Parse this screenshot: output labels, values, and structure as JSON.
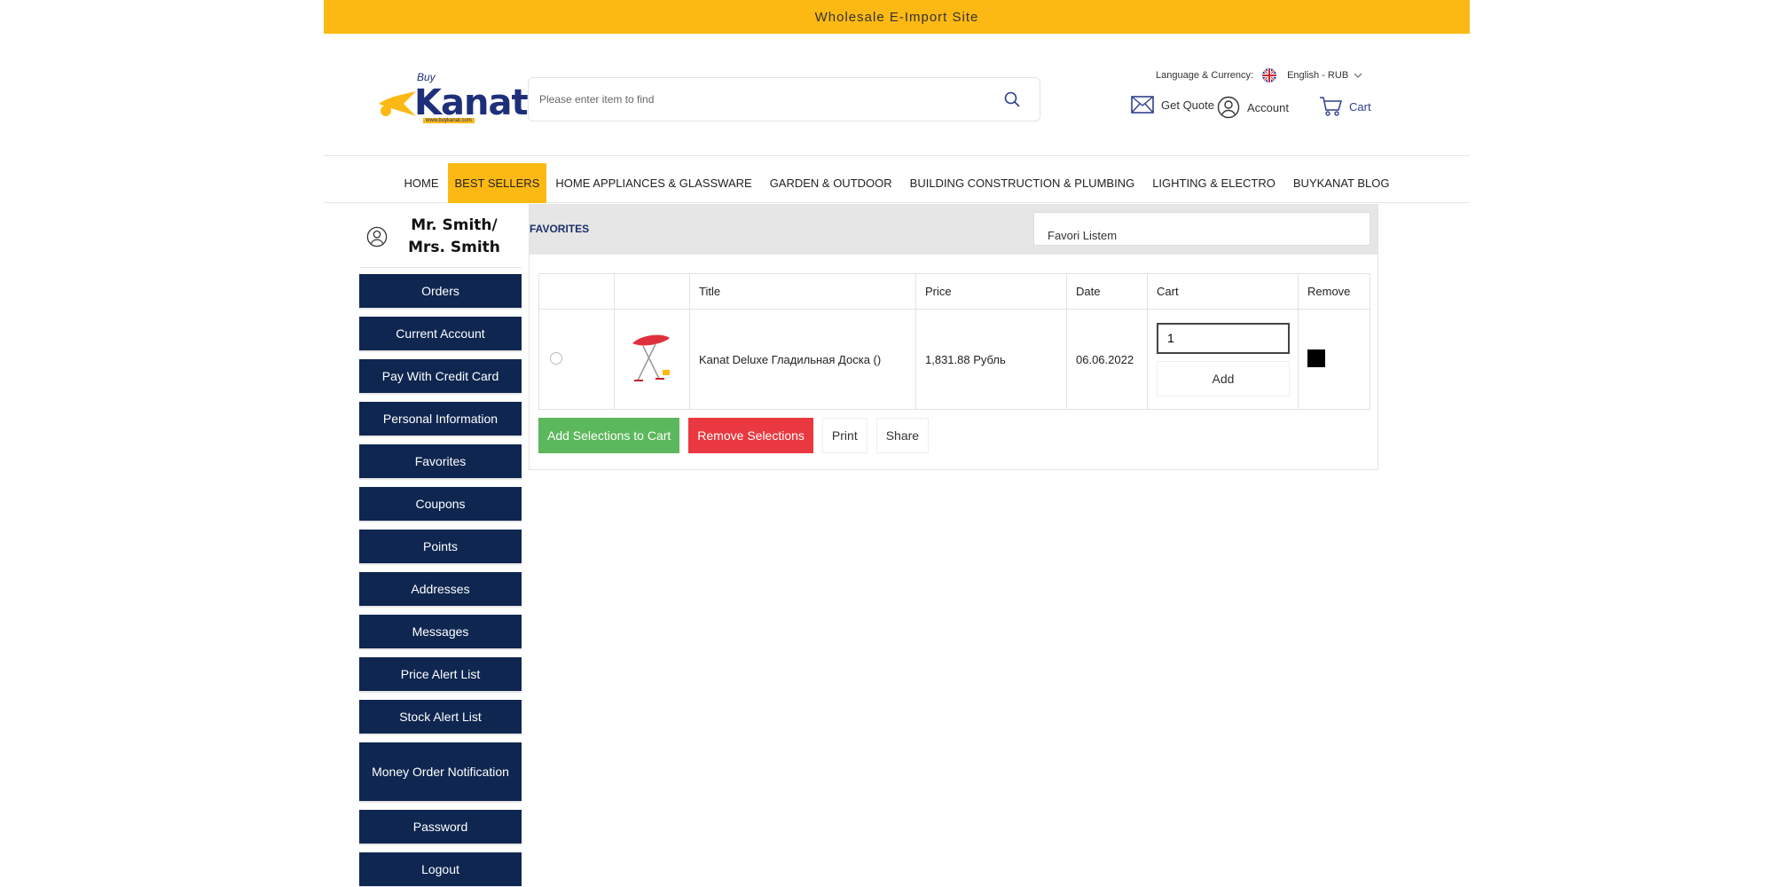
{
  "topbar": {
    "text": "Wholesale E-Import Site"
  },
  "logo": {
    "buy": "Buy",
    "word": "Kanat",
    "url": "www.buykanat.com"
  },
  "search": {
    "placeholder": "Please enter item to find"
  },
  "header": {
    "language_label": "Language & Currency:",
    "language_value": "English - RUB",
    "get_quote": "Get Quote",
    "account": "Account",
    "cart": "Cart"
  },
  "nav": {
    "items": [
      {
        "label": "HOME"
      },
      {
        "label": "BEST SELLERS"
      },
      {
        "label": "HOME APPLIANCES & GLASSWARE"
      },
      {
        "label": "GARDEN & OUTDOOR"
      },
      {
        "label": "BUILDING CONSTRUCTION & PLUMBING"
      },
      {
        "label": "LIGHTING & ELECTRO"
      },
      {
        "label": "BUYKANAT BLOG"
      }
    ]
  },
  "sidebar": {
    "user_line1": "Mr. Smith/",
    "user_line2": "Mrs. Smith",
    "items": [
      {
        "label": "Orders"
      },
      {
        "label": "Current Account"
      },
      {
        "label": "Pay With Credit Card"
      },
      {
        "label": "Personal Information"
      },
      {
        "label": "Favorites"
      },
      {
        "label": "Coupons"
      },
      {
        "label": "Points"
      },
      {
        "label": "Addresses"
      },
      {
        "label": "Messages"
      },
      {
        "label": "Price Alert List"
      },
      {
        "label": "Stock Alert List"
      },
      {
        "label": "Money Order Notification"
      },
      {
        "label": "Password"
      },
      {
        "label": "Logout"
      }
    ]
  },
  "favorites": {
    "title": "FAVORITES",
    "list_name": "Favori Listem",
    "columns": {
      "title": "Title",
      "price": "Price",
      "date": "Date",
      "cart": "Cart",
      "remove": "Remove"
    },
    "rows": [
      {
        "title": "Kanat Deluxe Гладильная Доска ()",
        "price": "1,831.88 Рубль",
        "date": "06.06.2022",
        "qty": "1",
        "add": "Add"
      }
    ],
    "actions": {
      "add_selections": "Add Selections to Cart",
      "remove_selections": "Remove Selections",
      "print": "Print",
      "share": "Share"
    }
  },
  "colors": {
    "accent": "#fdb913",
    "navy": "#0f2650",
    "green": "#5cb85c",
    "red": "#e9383f"
  }
}
